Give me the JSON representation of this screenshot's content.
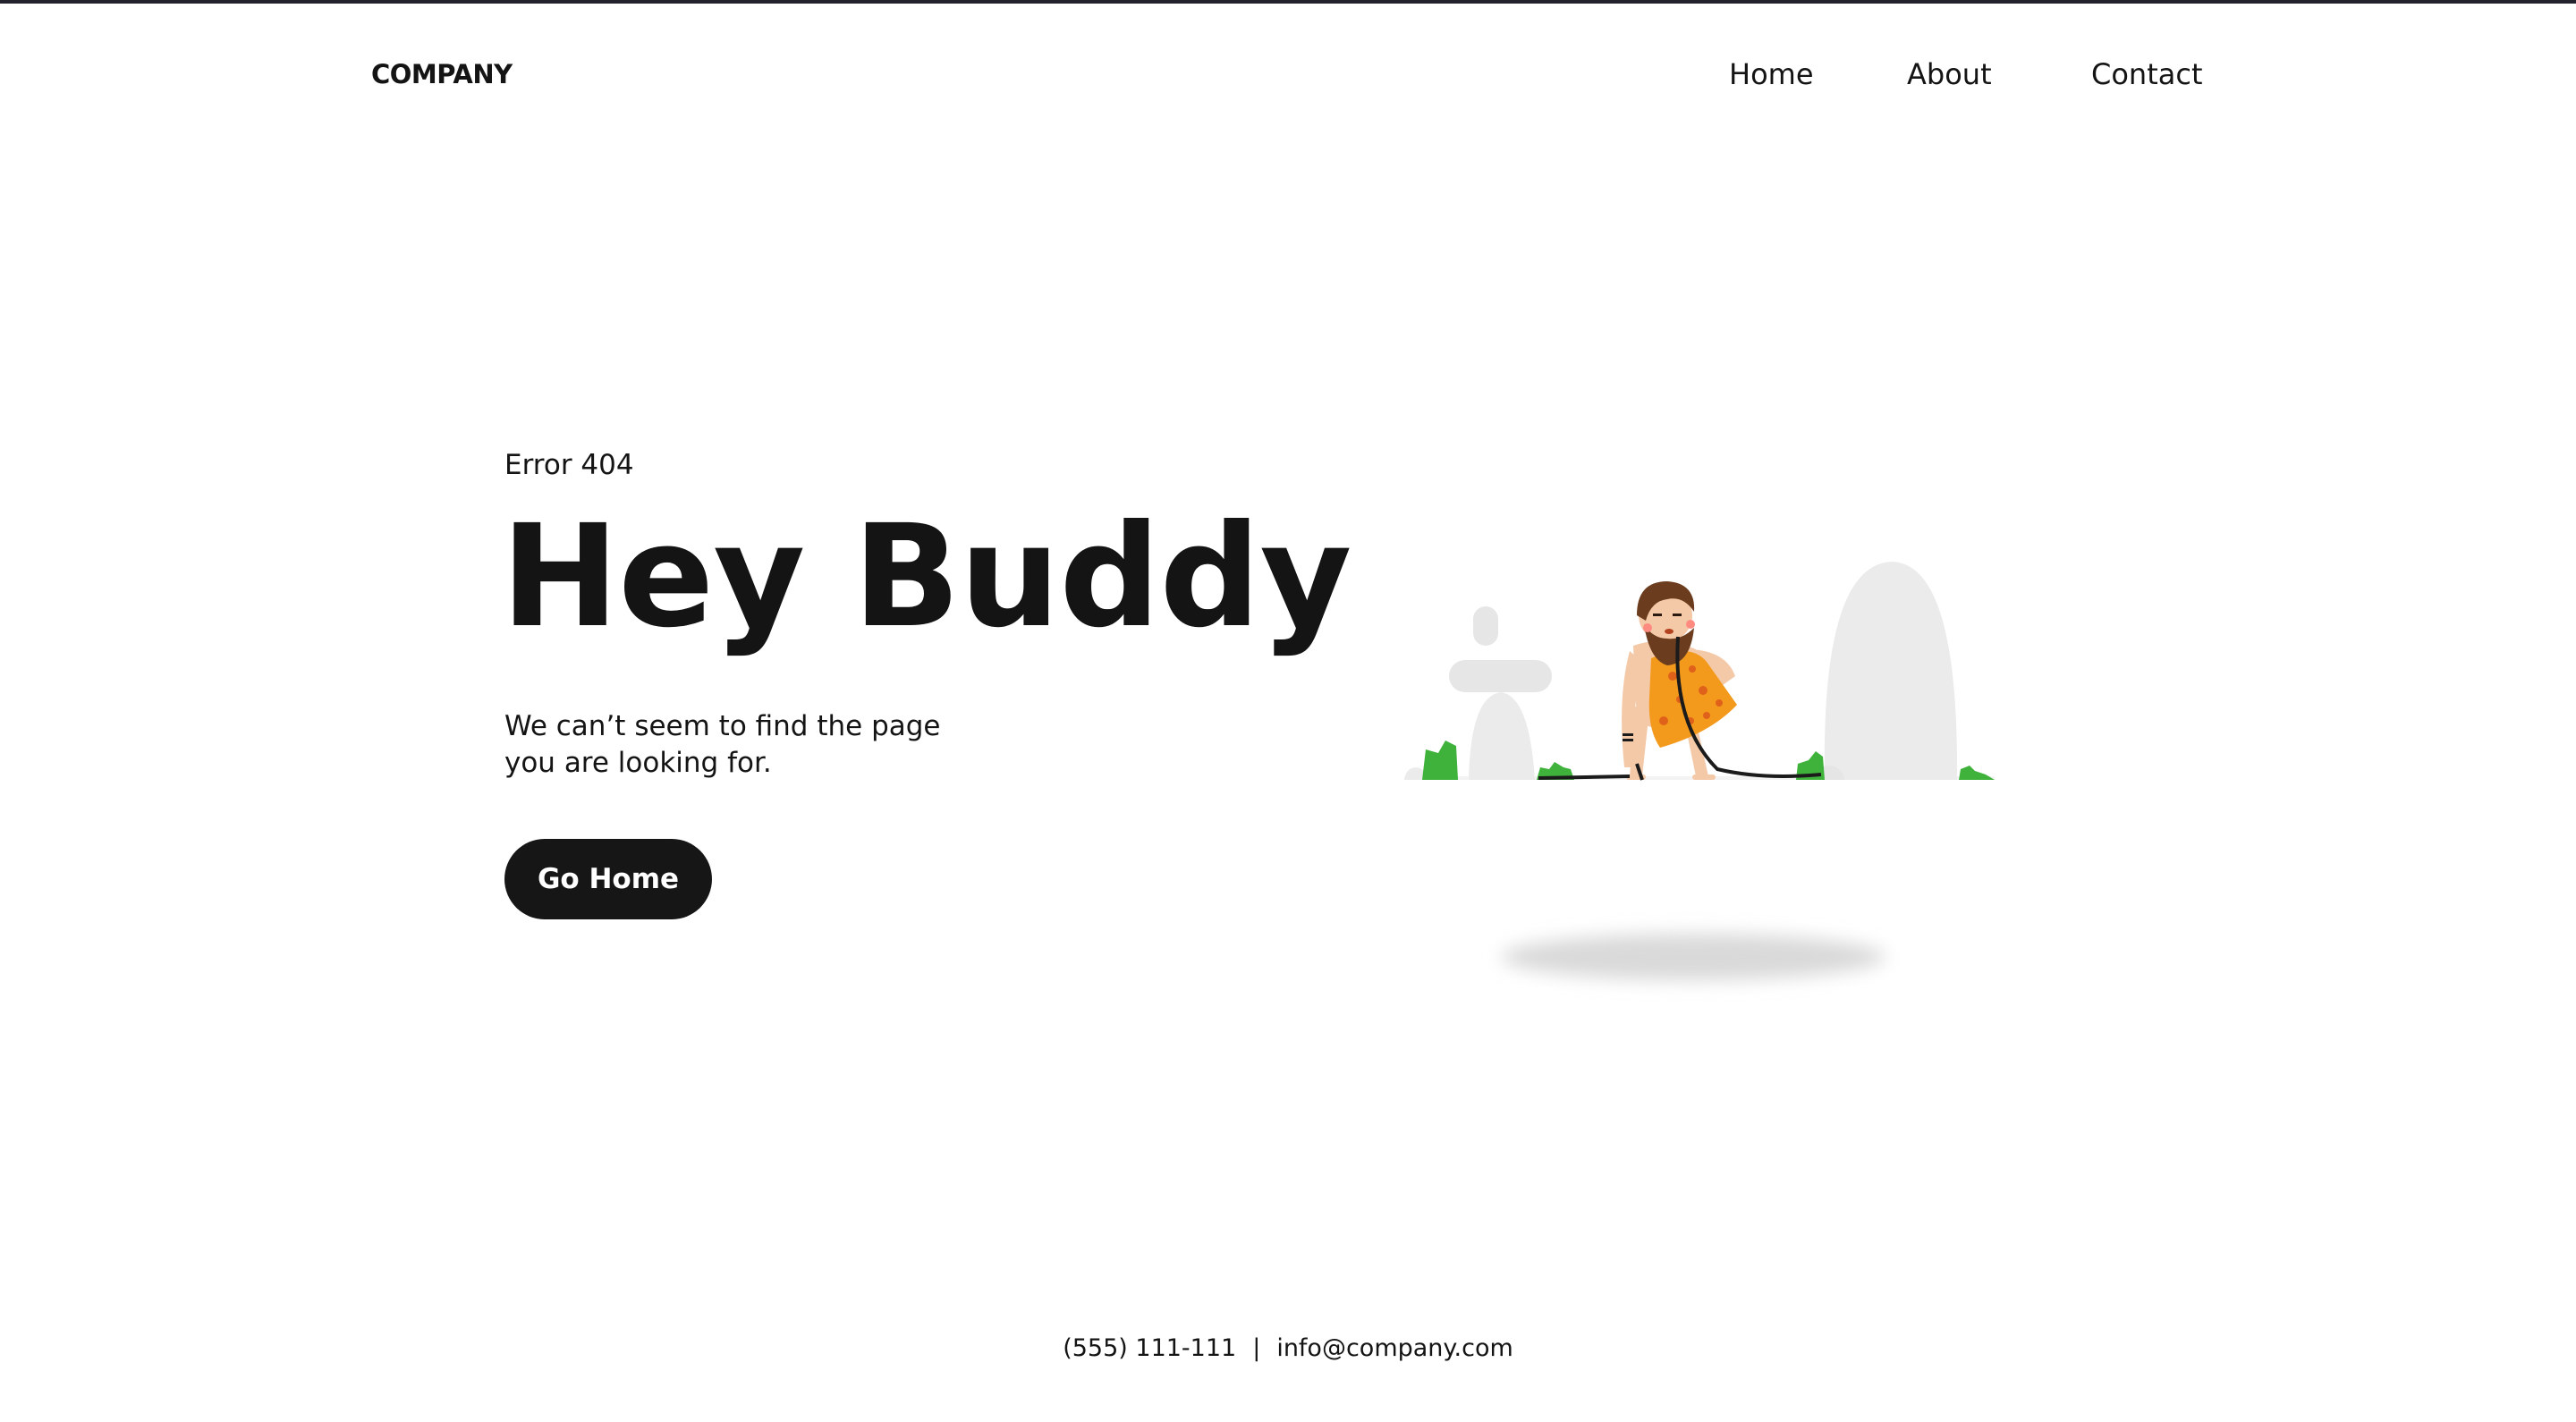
{
  "header": {
    "logo": "COMPANY",
    "nav": [
      "Home",
      "About",
      "Contact"
    ]
  },
  "hero": {
    "error_label": "Error 404",
    "headline": "Hey Buddy",
    "message_line1": "We can’t seem to find the page",
    "message_line2": "you are looking for.",
    "cta_label": "Go Home"
  },
  "footer": {
    "phone": "(555) 111-111",
    "separator": "|",
    "email": "info@company.com"
  },
  "colors": {
    "text": "#141414",
    "button_bg": "#161616",
    "button_text": "#ffffff",
    "top_border": "#24232d",
    "rock": "#ebebeb",
    "bush": "#3fb23c",
    "garment": "#f39a1d"
  },
  "icons": [
    "caveman-illustration"
  ]
}
